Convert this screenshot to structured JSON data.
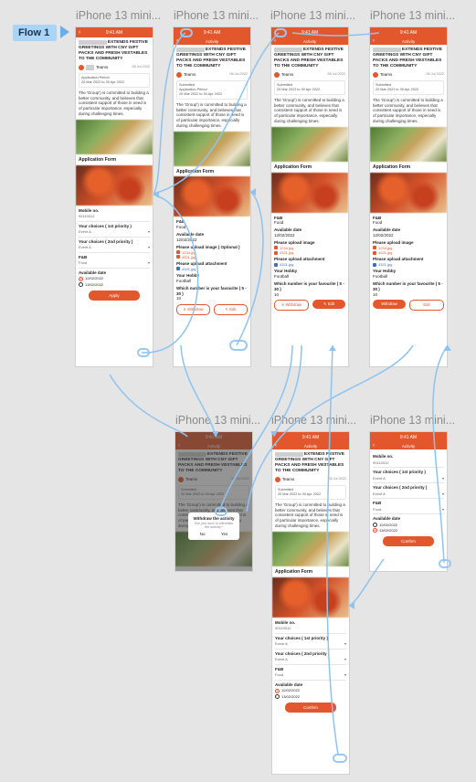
{
  "flow": {
    "label": "Flow 1"
  },
  "frames": [
    {
      "id": "f1",
      "title": "iPhone 13 mini..."
    },
    {
      "id": "f2",
      "title": "iPhone 13 mini..."
    },
    {
      "id": "f3",
      "title": "iPhone 13 mini..."
    },
    {
      "id": "f4",
      "title": "iPhone 13 mini..."
    },
    {
      "id": "f5",
      "title": "iPhone 13 mini..."
    },
    {
      "id": "f6",
      "title": "iPhone 13 mini..."
    },
    {
      "id": "f7",
      "title": "iPhone 13 mini..."
    }
  ],
  "app": {
    "status_time": "9:41 AM",
    "nav_title": "Activity",
    "headline_rest": "EXTENDS FESTIVE GREETINGS WITH CNY GIFT PACKS AND FRESH VESTABLES TO THE COMMUNITY",
    "org_label": "Teams",
    "post_date": "08 Jul 2022",
    "status_label": "Submitted",
    "period_label": "Application Period",
    "period_value": "20 Mar 2022 to 30 Apr 2022",
    "body_text": "The 'Group') is committed to building a better community, and believes that consistent support of those in need is of particular importance, especially during challenging times.",
    "form_title": "Application Form",
    "mobile_label": "Mobile no.",
    "mobile_value": "90110012",
    "choice1_label": "Your choices ( 1st priority )",
    "choice1_value": "Event A",
    "choice2_label": "Your choices ( 2nd priority )",
    "choice2_value": "Event A",
    "fb_label": "F&B",
    "fb_value": "Food",
    "available_label": "Available date",
    "date1": "12/02/2022",
    "date2": "13/02/2022",
    "apply_button": "Apply",
    "confirm_button": "Confirm",
    "upload_image_label": "Please upload image",
    "optional": "( Optional )",
    "file1": "1234.jpg",
    "file2": "4321.jpg",
    "attachment_label": "Please upload attachment",
    "file3": "4321.jpg",
    "hobby_label": "Your Hobby",
    "hobby_value": "Football",
    "fav_label": "Which number is your favourite ( 5 - 30 )",
    "fav_value": "10",
    "withdraw_button": "Withdraw",
    "edit_button": "Edit",
    "modal_title": "Withdraw the activity",
    "modal_sub": "Are you sure to withdraw the activity?",
    "modal_no": "No",
    "modal_yes": "Yes"
  },
  "colors": {
    "brand": "#e2572b",
    "link": "#6aaee8",
    "canvas": "#e5e5e5"
  }
}
